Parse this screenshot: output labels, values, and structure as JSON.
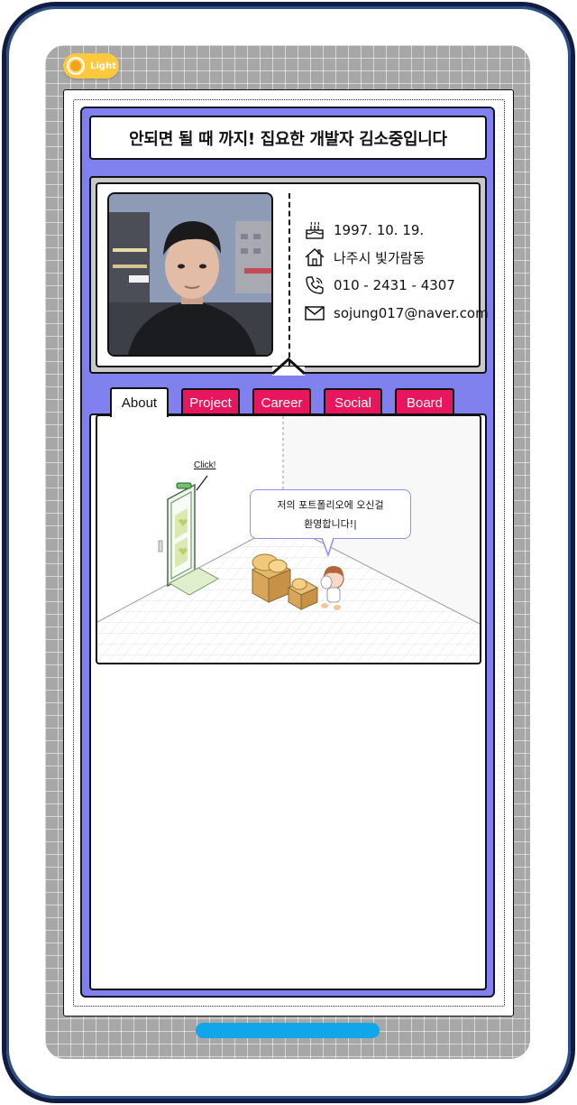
{
  "theme_toggle": {
    "label": "Light",
    "icon": "sun-icon"
  },
  "header": {
    "title": "안되면 될 때 까지! 집요한 개발자 김소중입니다"
  },
  "profile": {
    "photo": "profile-photo",
    "birthday": "1997. 10. 19.",
    "address": "나주시 빛가람동",
    "phone": "010 - 2431 - 4307",
    "email": "sojung017@naver.com",
    "icons": [
      "cake-icon",
      "home-icon",
      "phone-icon",
      "mail-icon"
    ]
  },
  "tabs": [
    {
      "label": "About",
      "active": true
    },
    {
      "label": "Project",
      "active": false
    },
    {
      "label": "Career",
      "active": false
    },
    {
      "label": "Social",
      "active": false
    },
    {
      "label": "Board",
      "active": false
    }
  ],
  "scene": {
    "click_label": "Click!",
    "bubble_line1": "저의 포트폴리오에 오신걸",
    "bubble_line2": "환영합니다!|"
  },
  "colors": {
    "frame_border": "#111c40",
    "board_bg": "#8080ee",
    "tab_inactive": "#e8175d",
    "toggle": "#ffc83d",
    "home_bar": "#11a6ea",
    "bubble_border": "#8a92f0"
  }
}
